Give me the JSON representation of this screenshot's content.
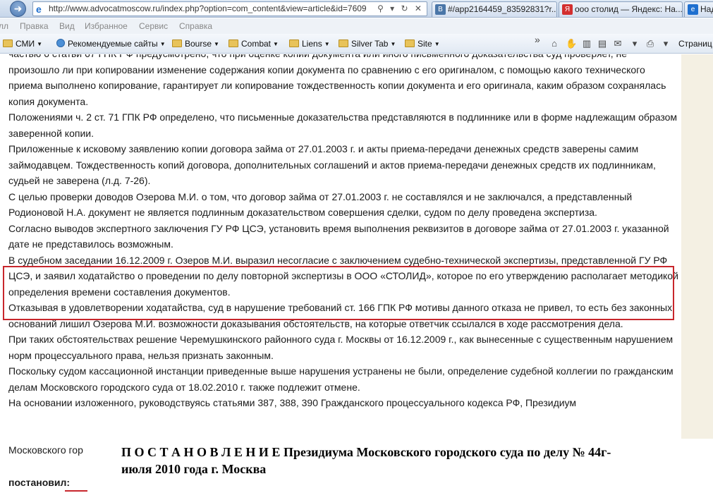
{
  "browser": {
    "url": "http://www.advocatmoscow.ru/index.php?option=com_content&view=article&id=7609",
    "url_tools": "⚲ ▾ ↻ ✕",
    "tabs": [
      {
        "label": "#/app2164459_83592831?r...",
        "icon": "vk-icon",
        "color": "#4a76a8"
      },
      {
        "label": "ооо столид — Яндекс: На...",
        "icon": "yandex-icon",
        "color": "#d32f2f"
      },
      {
        "label": "Над",
        "icon": "ie-icon",
        "color": "#1e6fcf"
      }
    ]
  },
  "menu": [
    "лл",
    "Правка",
    "Вид",
    "Избранное",
    "Сервис",
    "Справка"
  ],
  "favorites": {
    "items": [
      {
        "label": "СМИ",
        "dropdown": true
      },
      {
        "label": "Рекомендуемые сайты",
        "dropdown": true
      },
      {
        "label": "Bourse",
        "dropdown": true
      },
      {
        "label": "Combat",
        "dropdown": true
      },
      {
        "label": "Liens",
        "dropdown": true
      },
      {
        "label": "Silver Tab",
        "dropdown": true
      },
      {
        "label": "Site",
        "dropdown": true
      }
    ],
    "page_label": "Страниц"
  },
  "article": {
    "paragraphs": [
      "частью 6 статьи 67 ГПК РФ предусмотрено, что при оценке копии документа или иного письменного доказательства суд проверяет, не произошло ли при копировании изменение содержания копии документа по сравнению с его оригиналом, с помощью какого технического приема выполнено копирование, гарантирует ли копирование тождественность копии документа и его оригинала, каким образом сохранялась копия документа.",
      "Положениями ч. 2 ст. 71 ГПК РФ определено, что письменные доказательства представляются в подлиннике или в форме надлежащим образом заверенной копии.",
      "Приложенные к исковому заявлению копии договора займа от 27.01.2003 г. и акты приема-передачи денежных средств заверены самим займодавцем. Тождественность копий  договора, дополнительных соглашений и актов приема-передачи денежных средств их подлинникам, судьей не заверена (л.д. 7-26).",
      "С целью проверки доводов Озерова М.И. о том, что договор займа от 27.01.2003 г. не составлялся и не заключался, а представленный Родионовой Н.А. документ не является подлинным доказательством совершения сделки, судом по делу проведена экспертиза.",
      "Согласно выводов экспертного заключения ГУ РФ ЦСЭ, установить время выполнения реквизитов в договоре займа от 27.01.2003 г. указанной дате не представилось возможным.",
      "В судебном заседании 16.12.2009 г. Озеров М.И. выразил несогласие с заключением судебно-технической экспертизы, представленной ГУ РФ ЦСЭ, и заявил ходатайство о проведении по делу повторной экспертизы в ООО «СТОЛИД», которое по его утверждению располагает методикой определения времени составления документов.",
      "Отказывая в удовлетворении ходатайства, суд в нарушение требований  ст. 166 ГПК РФ мотивы данного отказа не привел, то есть без законных оснований лишил Озерова М.И. возможности доказывания обстоятельств, на которые ответчик ссылался в ходе рассмотрения дела.",
      "При таких обстоятельствах решение Черемушкинского районного суда      г. Москвы от 16.12.2009 г., как вынесенные с существенным нарушением норм процессуального права, нельзя признать законным.",
      "Поскольку судом кассационной инстанции приведенные выше нарушения устранены не были, определение судебной коллегии по гражданским делам Московского городского суда от 18.02.2010 г. также подлежит отмене.",
      "На основании изложенного, руководствуясь статьями 387, 388, 390 Гражданского процессуального кодекса РФ, Президиум"
    ],
    "prefix_text": "Московского гор",
    "overlay_title_line1": "П О С Т А Н О В Л Е Н И Е   Президиума Московского городского суда    по делу № 44г-",
    "overlay_title_line2": "июля 2010 года    г. Москва",
    "resolved": "постановил:",
    "highlight_color": "#c8262c"
  }
}
